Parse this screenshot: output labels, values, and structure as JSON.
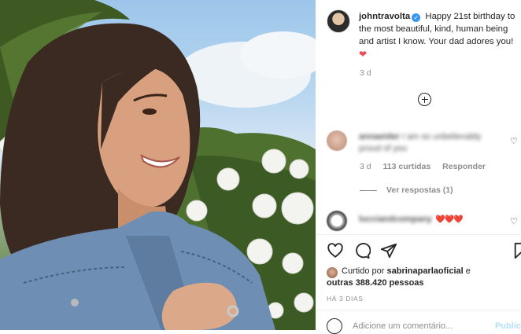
{
  "post": {
    "username": "johntravolta",
    "caption": "Happy 21st birthday to the most beautiful, kind, human being and artist I know. Your dad adores you!",
    "caption_emoji": "❤️",
    "time": "3 d",
    "heart_color": "#ed4956"
  },
  "comments": [
    {
      "username": "annaeider",
      "text": "I am so unbelievably proud of you",
      "time": "3 d",
      "likes": "113 curtidas",
      "reply_label": "Responder",
      "view_replies": "Ver respostas (1)"
    },
    {
      "username": "lucciandcompany",
      "text": "❤️❤️❤️"
    }
  ],
  "actions": {
    "like_icon": "heart-outline-icon",
    "comment_icon": "speech-bubble-icon",
    "share_icon": "paper-plane-icon",
    "save_icon": "bookmark-icon"
  },
  "likes": {
    "prefix": "Curtido por",
    "user": "sabrinaparlaoficial",
    "connector": "e",
    "others": "outras 388.420 pessoas"
  },
  "post_time": "HÁ 3 DIAS",
  "comment_input": {
    "placeholder": "Adicione um comentário...",
    "publish_label": "Publicar"
  }
}
